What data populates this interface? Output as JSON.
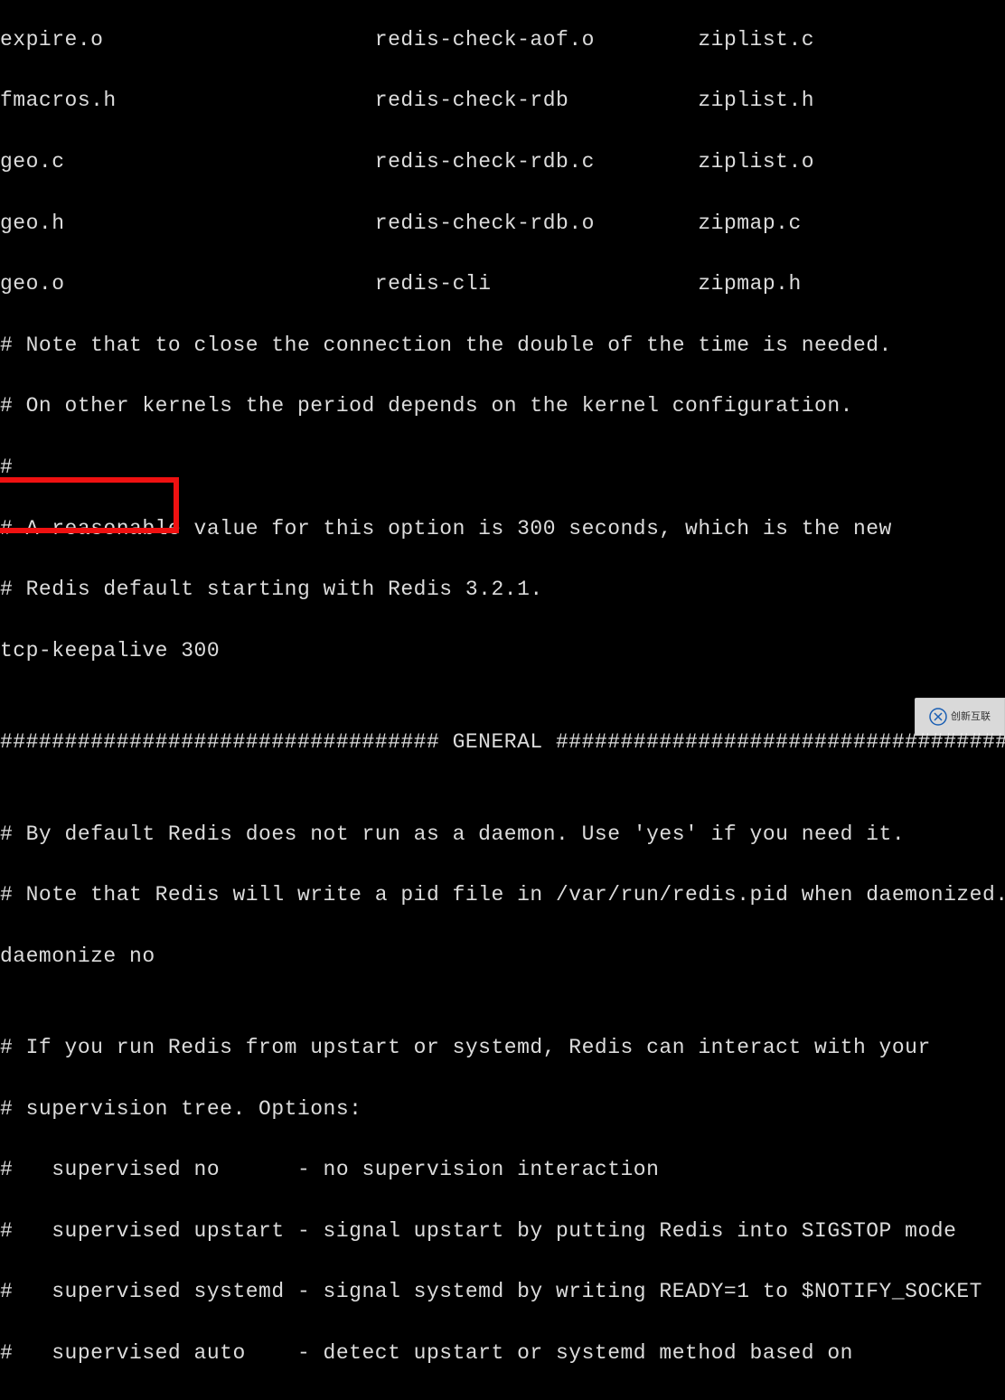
{
  "files": {
    "col1": [
      "expire.o",
      "fmacros.h",
      "geo.c",
      "geo.h",
      "geo.o"
    ],
    "col2": [
      "redis-check-aof.o",
      "redis-check-rdb",
      "redis-check-rdb.c",
      "redis-check-rdb.o",
      "redis-cli"
    ],
    "col3": [
      "ziplist.c",
      "ziplist.h",
      "ziplist.o",
      "zipmap.c",
      "zipmap.h"
    ]
  },
  "config": {
    "comment1": "# Note that to close the connection the double of the time is needed.",
    "comment2": "# On other kernels the period depends on the kernel configuration.",
    "comment3": "#",
    "comment4": "# A reasonable value for this option is 300 seconds, which is the new",
    "comment5": "# Redis default starting with Redis 3.2.1.",
    "tcp_line": "tcp-keepalive 300",
    "blank1": "",
    "general_divider": "################################## GENERAL #####################################",
    "blank2": "",
    "comment6": "# By default Redis does not run as a daemon. Use 'yes' if you need it.",
    "comment7": "# Note that Redis will write a pid file in /var/run/redis.pid when daemonized.",
    "daemonize": "daemonize no",
    "blank3": "",
    "comment8": "# If you run Redis from upstart or systemd, Redis can interact with your",
    "comment9": "# supervision tree. Options:",
    "comment10": "#   supervised no      - no supervision interaction",
    "comment11": "#   supervised upstart - signal upstart by putting Redis into SIGSTOP mode",
    "comment12": "#   supervised systemd - signal systemd by writing READY=1 to $NOTIFY_SOCKET",
    "comment13": "#   supervised auto    - detect upstart or systemd method based on"
  },
  "watermark": {
    "text": "创新互联"
  }
}
